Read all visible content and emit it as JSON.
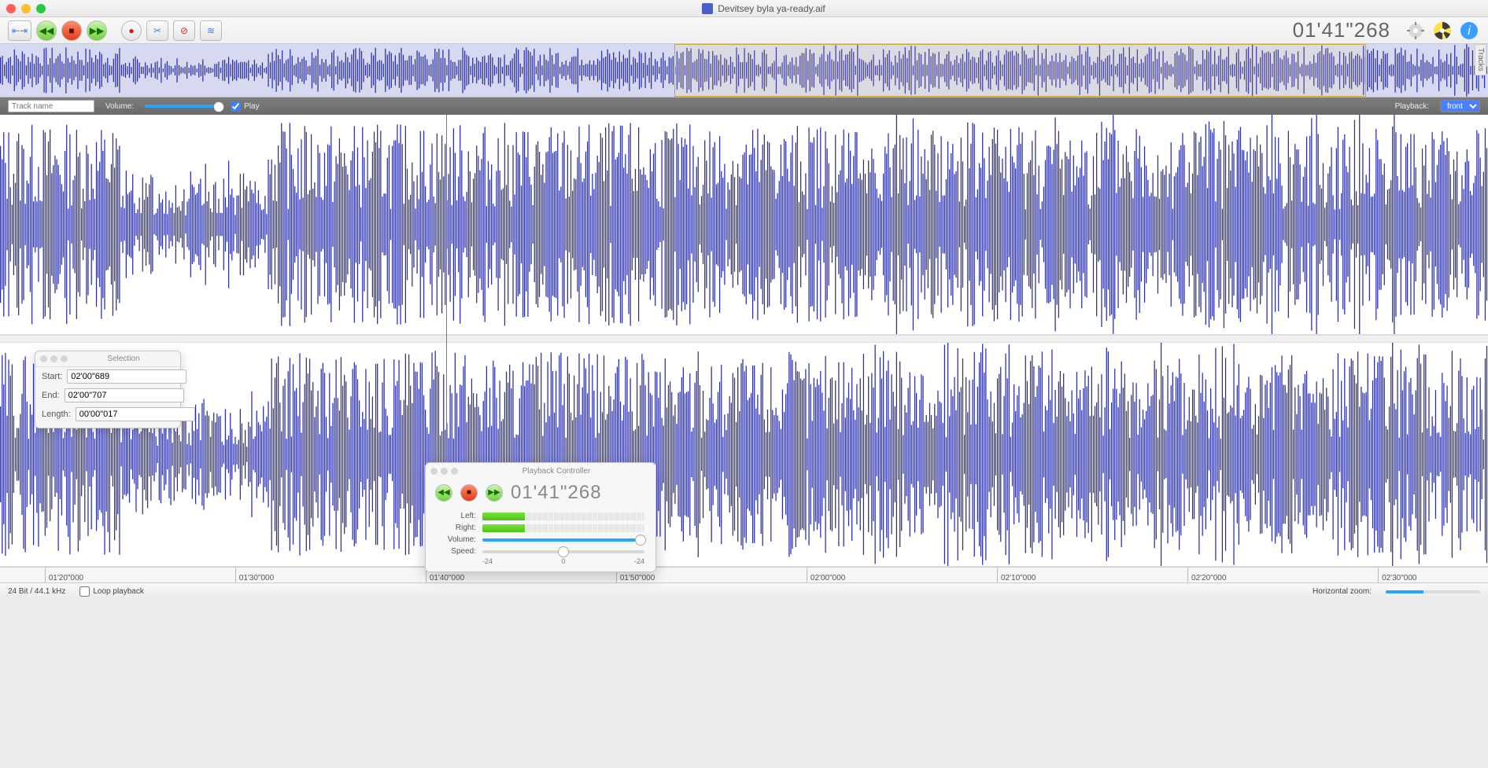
{
  "window": {
    "title": "Devitsey byla ya-ready.aif",
    "tracks_label": "Tracks"
  },
  "toolbar": {
    "time": "01'41\"268"
  },
  "trackbar": {
    "trackname_placeholder": "Track name",
    "volume_label": "Volume:",
    "play_label": "Play",
    "playback_label": "Playback:",
    "playback_mode": "front"
  },
  "ruler": {
    "ticks": [
      "01'20\"000",
      "01'30\"000",
      "01'40\"000",
      "01'50\"000",
      "02'00\"000",
      "02'10\"000",
      "02'20\"000",
      "02'30\"000"
    ]
  },
  "status": {
    "format": "24 Bit / 44.1 kHz",
    "loop_label": "Loop playback",
    "hzoom_label": "Horizontal zoom:"
  },
  "selection_panel": {
    "title": "Selection",
    "start_label": "Start:",
    "start_value": "02'00\"689",
    "end_label": "End:",
    "end_value": "02'00\"707",
    "length_label": "Length:",
    "length_value": "00'00\"017"
  },
  "playback_panel": {
    "title": "Playback Controller",
    "time": "01'41\"268",
    "left_label": "Left:",
    "right_label": "Right:",
    "volume_label": "Volume:",
    "speed_label": "Speed:",
    "scale_min": "-24",
    "scale_mid": "0",
    "scale_max": "-24"
  }
}
